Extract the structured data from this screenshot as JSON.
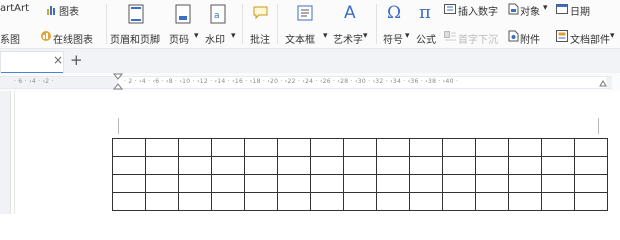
{
  "ribbon": {
    "top_row": {
      "smartart": "artArt",
      "chart": "图表",
      "insert_number": "插入数字",
      "object": "对象",
      "date": "日期"
    },
    "bottom_row": {
      "relation_graph": "系图",
      "online_chart": "在线图表",
      "header_footer": "页眉和页脚",
      "page_number": "页码",
      "watermark": "水印",
      "comment": "批注",
      "textbox": "文本框",
      "wordart": "艺术字",
      "symbol": "符号",
      "formula": "公式",
      "drop_cap": "首字下沉",
      "attachment": "附件",
      "doc_parts": "文档部件"
    },
    "dropdown_glyph": "▾"
  },
  "tabs": {
    "close_glyph": "×",
    "add_glyph": "+"
  },
  "ruler": {
    "left_text": "· 6 · ‹4 · ‹2 ·",
    "right_text": "· 2 · ‹4 · ‹6 · ‹8 · ‹10 · ‹12 · ‹14 · ‹16 · ‹18 · ‹20 · ‹22 · ‹24 · ‹26 · ‹28 · ‹30 · ‹32 · ‹34 · ‹36 · ‹38 · ‹40 ·"
  },
  "table": {
    "rows": 4,
    "cols": 15
  },
  "colors": {
    "ribbon_bg": "#fbfbfb",
    "icon_blue": "#3b6fc6",
    "accent": "#4a83d6",
    "table_border": "#333333"
  }
}
